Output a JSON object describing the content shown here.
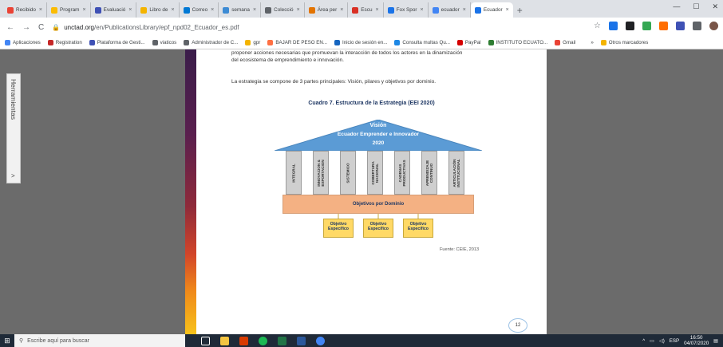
{
  "tabs": [
    {
      "label": "Recibido",
      "fav_color": "#ea4335"
    },
    {
      "label": "Program",
      "fav_color": "#fbbc04"
    },
    {
      "label": "Evaluació",
      "fav_color": "#3f51b5"
    },
    {
      "label": "Libro de",
      "fav_color": "#f4b400"
    },
    {
      "label": "Correo",
      "fav_color": "#0078d4"
    },
    {
      "label": "semana",
      "fav_color": "#3d8bd4"
    },
    {
      "label": "Colecció",
      "fav_color": "#5f6368"
    },
    {
      "label": "Área per",
      "fav_color": "#e37400"
    },
    {
      "label": "Escu",
      "fav_color": "#d93025"
    },
    {
      "label": "Fox Spor",
      "fav_color": "#1a73e8"
    },
    {
      "label": "ecuador",
      "fav_color": "#4285f4"
    },
    {
      "label": "Ecuador",
      "fav_color": "#1a73e8",
      "active": true
    }
  ],
  "new_tab": "+",
  "window_controls": {
    "minimize": "—",
    "maximize": "☐",
    "close": "✕"
  },
  "nav": {
    "back": "←",
    "forward": "→",
    "reload": "C"
  },
  "url": {
    "host": "unctad.org",
    "path": "/en/PublicationsLibrary/epf_npd02_Ecuador_es.pdf"
  },
  "bookmarks": [
    {
      "label": "Aplicaciones",
      "color": "#4285f4"
    },
    {
      "label": "Registration",
      "color": "#c62828"
    },
    {
      "label": "Plataforma de Gesti...",
      "color": "#3f51b5"
    },
    {
      "label": "viaticos",
      "color": "#5f6368"
    },
    {
      "label": "Administrador de C...",
      "color": "#5f6368"
    },
    {
      "label": "gpr",
      "color": "#f4b400"
    },
    {
      "label": "BAJAR DE PESO EN...",
      "color": "#ff7043"
    },
    {
      "label": "Inicio de sesión en...",
      "color": "#1565c0"
    },
    {
      "label": "Consulta multas Qu...",
      "color": "#1e88e5"
    },
    {
      "label": "PayPal",
      "color": "#d50000"
    },
    {
      "label": "INSTITUTO ECUATO...",
      "color": "#2e7d32"
    },
    {
      "label": "Gmail",
      "color": "#ea4335"
    },
    {
      "label": "»",
      "color": "#ffffff"
    },
    {
      "label": "Otros marcadores",
      "color": "#f4b400"
    }
  ],
  "side_panel": {
    "label": "Herramientas",
    "arrow": ">"
  },
  "document": {
    "para_lines": [
      "proponer acciones necesarias que promuevan la interacción de todos los actores en la dinamización",
      "del ecosistema de emprendimiento e innovación."
    ],
    "para2": "La estrategia se compone de 3 partes principales: Visión, pilares y objetivos por dominio.",
    "figure_title": "Cuadro 7. Estructura de la Estrategia (EEI 2020)",
    "roof_lines": [
      "Visión",
      "Ecuador Emprender e Innovador",
      "2020"
    ],
    "pillars": [
      "INTEGRAL",
      "INNOVACION &\nEXPORTACION",
      "SISTEMICO",
      "COBERTURA\nNACIONAL",
      "CADENAS\nPRODUCTIVAS",
      "APRENDIZAJE\nCONTINUO",
      "ARTICULACIÓN\nINSTITUCIONAL"
    ],
    "base_label": "Objetivos por Dominio",
    "objectives": [
      "Objetivo Específico",
      "Objetivo Específico",
      "Objetivo Específico"
    ],
    "source": "Fuente: CEIE, 2013",
    "page_number": "12"
  },
  "taskbar": {
    "search_placeholder": "Escribe aquí para buscar",
    "lang": "ESP",
    "time": "16:50",
    "date": "04/07/2020"
  }
}
